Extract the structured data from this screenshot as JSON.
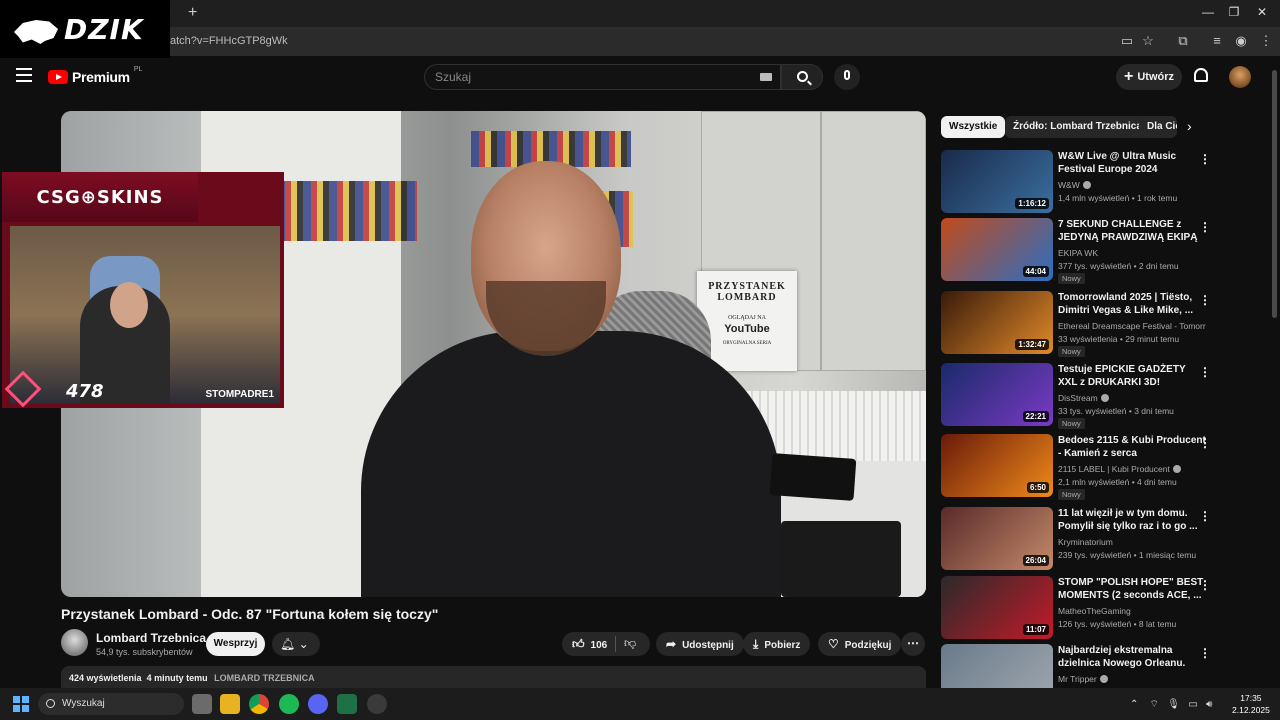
{
  "browser": {
    "url": "atch?v=FHHcGTP8gWk",
    "tab_close": "×",
    "new_tab": "+",
    "window_controls": [
      "—",
      "❐",
      "✕"
    ]
  },
  "overlay_logo": {
    "text": "DZIK"
  },
  "header": {
    "logo_text": "Premium",
    "region": "PL",
    "search_placeholder": "Szukaj",
    "create_label": "Utwórz",
    "create_plus": "+"
  },
  "video": {
    "sign": {
      "line1": "PRZYSTANEK",
      "line1b": "LOMBARD",
      "line2": "OGLĄDAJ NA",
      "line3": "YouTube",
      "line4": "ORYGINALNA SERIA"
    },
    "cam_overlay": {
      "banner": "CSG⊕SKINS",
      "tiktok": "STOMPADRE1",
      "number": "478"
    }
  },
  "info": {
    "title": "Przystanek Lombard - Odc. 87 \"Fortuna kołem się toczy\"",
    "channel_name": "Lombard Trzebnica",
    "channel_subs": "54,9 tys. subskrybentów",
    "support_label": "Wesprzyj",
    "like_count": "106",
    "share_label": "Udostępnij",
    "download_label": "Pobierz",
    "thanks_label": "Podziękuj",
    "views": "424 wyświetlenia",
    "time_ago": "4 minuty temu",
    "tag": "LOMBARD TRZEBNICA"
  },
  "sidebar": {
    "chips": [
      "Wszystkie",
      "Źródło: Lombard Trzebnica",
      "Dla Ciebie"
    ],
    "recommendations": [
      {
        "title": "W&W Live @ Ultra Music Festival Europe 2024",
        "channel": "W&W",
        "verified": true,
        "meta": "1,4 mln wyświetleń • 1 rok temu",
        "duration": "1:16:12",
        "badge": "",
        "c1": "#1a2a4a",
        "c2": "#3a6fa0"
      },
      {
        "title": "7 SEKUND CHALLENGE z JEDYNĄ PRAWDZIWĄ EKIPĄ",
        "channel": "EKIPA WK",
        "verified": false,
        "meta": "377 tys. wyświetleń • 2 dni temu",
        "duration": "44:04",
        "badge": "Nowy",
        "c1": "#c24a1a",
        "c2": "#2a6fc4"
      },
      {
        "title": "Tomorrowland 2025 | Tiësto, Dimitri Vegas & Like Mike, ...",
        "channel": "Ethereal Dreamscape Festival - Tomorro...",
        "verified": false,
        "meta": "33 wyświetlenia • 29 minut temu",
        "duration": "1:32:47",
        "badge": "Nowy",
        "c1": "#3a1a0a",
        "c2": "#e08a2a"
      },
      {
        "title": "Testuje EPICKIE GADŻETY XXL z DRUKARKI 3D!",
        "channel": "DisStream",
        "verified": true,
        "meta": "33 tys. wyświetleń • 3 dni temu",
        "duration": "22:21",
        "badge": "Nowy",
        "c1": "#1a2a6a",
        "c2": "#7a3ac4"
      },
      {
        "title": "Bedoes 2115 & Kubi Producent - Kamień z serca",
        "channel": "2115 LABEL  | Kubi Producent",
        "verified": true,
        "meta": "2,1 mln wyświetleń • 4 dni temu",
        "duration": "6:50",
        "badge": "Nowy",
        "c1": "#6a1a0a",
        "c2": "#f08a1a"
      },
      {
        "title": "11 lat więził je w tym domu. Pomylił się tylko raz i to go ...",
        "channel": "Kryminatorium",
        "verified": false,
        "meta": "239 tys. wyświetleń • 1 miesiąc temu",
        "duration": "26:04",
        "badge": "",
        "c1": "#5a2a2a",
        "c2": "#c48a6a"
      },
      {
        "title": "STOMP \"POLISH HOPE\" BEST MOMENTS (2 seconds ACE, ...",
        "channel": "MatheoTheGaming",
        "verified": false,
        "meta": "126 tys. wyświetleń • 8 lat temu",
        "duration": "11:07",
        "badge": "",
        "c1": "#2a2a2a",
        "c2": "#c41a2a"
      },
      {
        "title": "Najbardziej ekstremalna dzielnica Nowego Orleanu.",
        "channel": "Mr Tripper",
        "verified": true,
        "meta": "",
        "duration": "",
        "badge": "",
        "c1": "#6a7a8a",
        "c2": "#a0a8b0"
      }
    ]
  },
  "taskbar": {
    "search_label": "Wyszukaj",
    "time": "17:35",
    "date": "2.12.2025"
  }
}
